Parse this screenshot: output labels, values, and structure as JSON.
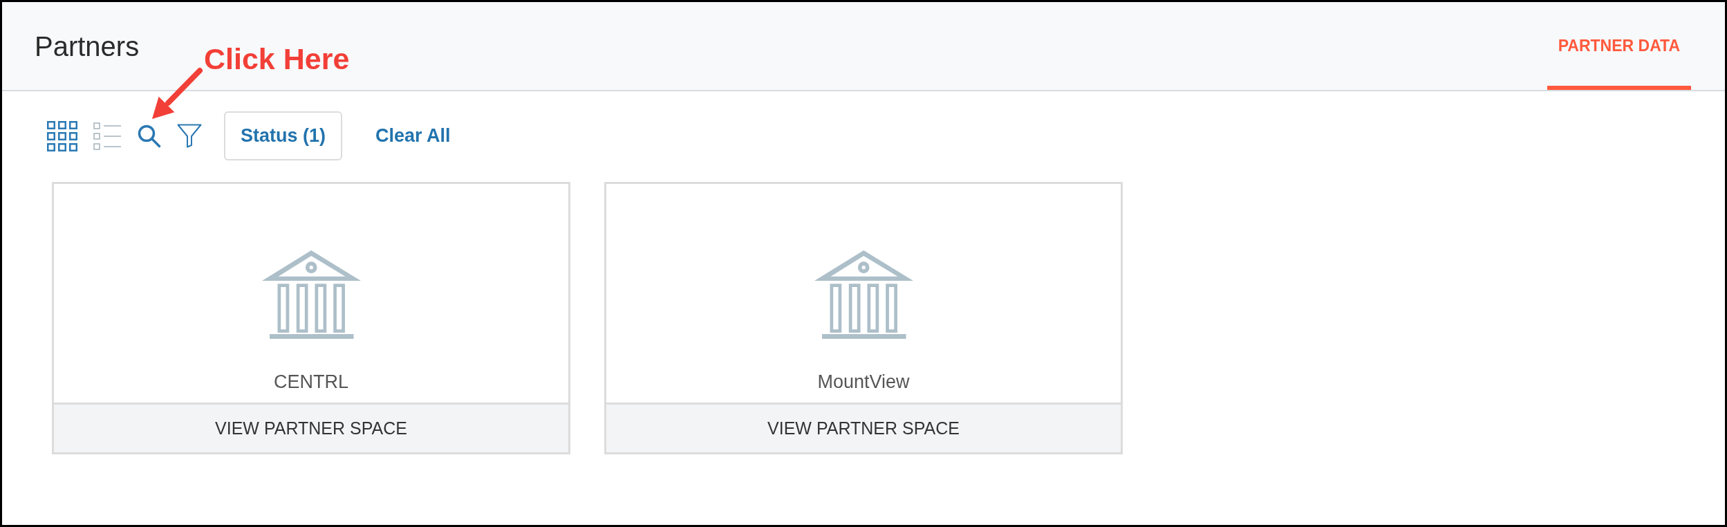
{
  "header": {
    "title": "Partners",
    "tabs": [
      {
        "label": "PARTNER DATA",
        "selected": true
      }
    ]
  },
  "annotation": {
    "text": "Click Here"
  },
  "toolbar": {
    "views": [
      {
        "kind": "grid",
        "selected": true
      },
      {
        "kind": "list",
        "selected": false
      }
    ],
    "tools": [
      {
        "kind": "search"
      },
      {
        "kind": "filter"
      }
    ],
    "status_filter": "Status (1)",
    "clear_all": "Clear All"
  },
  "cards": [
    {
      "name": "CENTRL",
      "action": "VIEW PARTNER SPACE"
    },
    {
      "name": "MountView",
      "action": "VIEW PARTNER SPACE"
    }
  ]
}
